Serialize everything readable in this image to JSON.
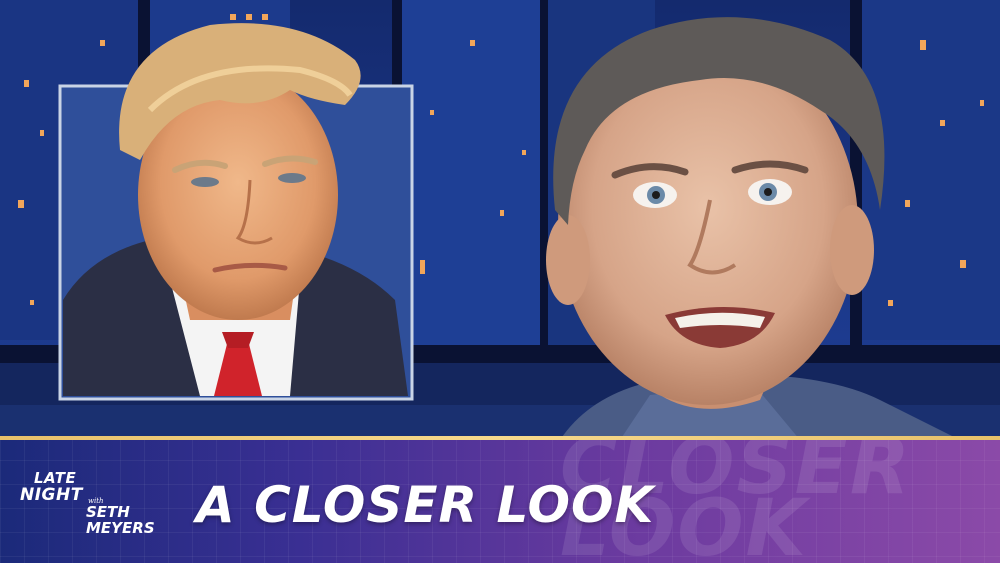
{
  "show": {
    "logo_line1": "LATE",
    "logo_line2": "NIGHT",
    "logo_line3": "with",
    "logo_line4": "SETH",
    "logo_line5": "MEYERS"
  },
  "segment": {
    "title": "A CLOSER LOOK"
  },
  "banner_background_text": "CLOSER\nLOOK",
  "colors": {
    "backdrop": "#0b1540",
    "banner_left": "#1b2a7a",
    "banner_right": "#8b4aa8",
    "banner_rule": "#f7d98c",
    "title_text": "#ffffff",
    "pip_border": "#c9d4e6"
  }
}
